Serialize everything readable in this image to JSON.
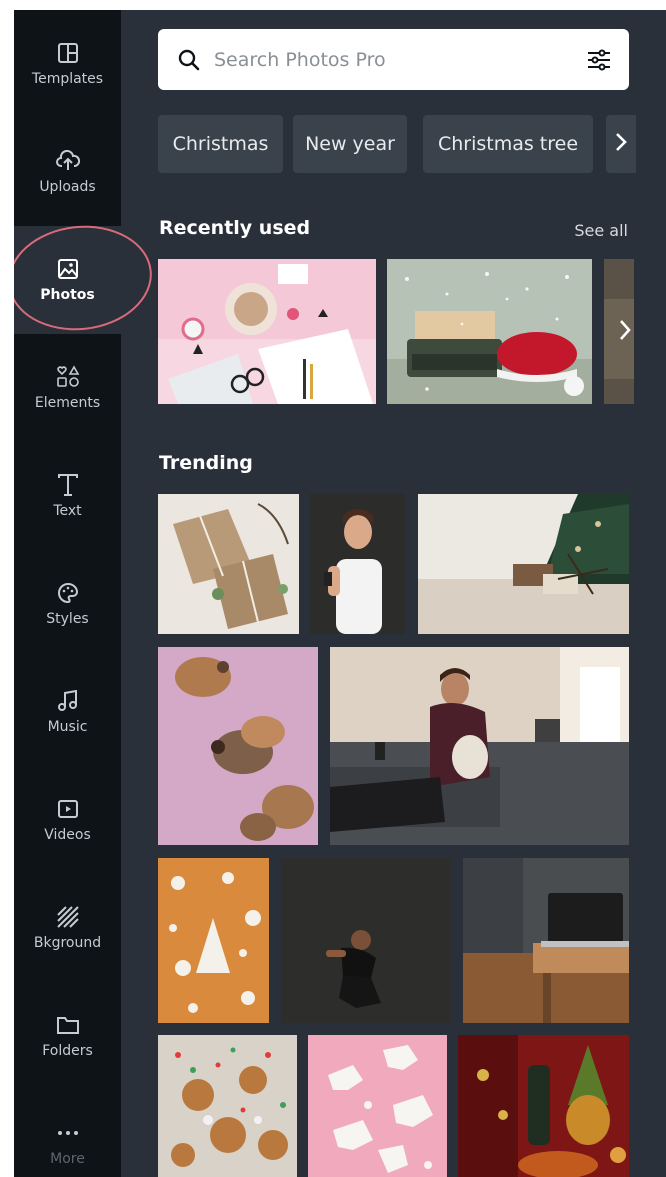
{
  "sidebar": {
    "items": [
      {
        "label": "Templates",
        "icon": "templates-icon"
      },
      {
        "label": "Uploads",
        "icon": "upload-cloud-icon"
      },
      {
        "label": "Photos",
        "icon": "image-icon",
        "active": true
      },
      {
        "label": "Elements",
        "icon": "shapes-icon"
      },
      {
        "label": "Text",
        "icon": "text-icon"
      },
      {
        "label": "Styles",
        "icon": "palette-icon"
      },
      {
        "label": "Music",
        "icon": "music-note-icon"
      },
      {
        "label": "Videos",
        "icon": "video-play-icon"
      },
      {
        "label": "Bkground",
        "icon": "background-pattern-icon"
      },
      {
        "label": "Folders",
        "icon": "folder-icon"
      },
      {
        "label": "More",
        "icon": "more-dots-icon"
      }
    ]
  },
  "search": {
    "placeholder": "Search Photos Pro"
  },
  "chips": [
    "Christmas",
    "New year",
    "Christmas tree"
  ],
  "recent": {
    "title": "Recently used",
    "see_all": "See all"
  },
  "trending": {
    "title": "Trending"
  },
  "colors": {
    "panel_bg": "#293039",
    "sidebar_bg": "#0e1318",
    "chip_bg": "#3a424c",
    "annotation": "#d86b7b"
  }
}
